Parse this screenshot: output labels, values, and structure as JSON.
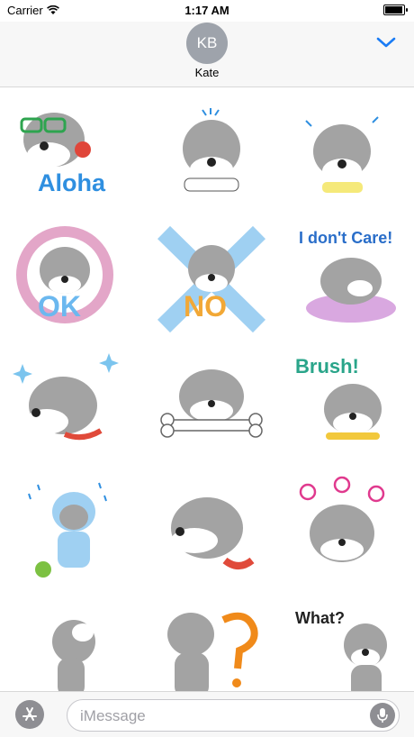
{
  "status_bar": {
    "carrier": "Carrier",
    "time": "1:17 AM"
  },
  "header": {
    "avatar_initials": "KB",
    "contact_name": "Kate"
  },
  "stickers": [
    {
      "label": "Aloha",
      "color": "#2f8fe0"
    },
    {
      "label": ""
    },
    {
      "label": ""
    },
    {
      "label": "OK",
      "color": "#6bb8ef"
    },
    {
      "label": "NO",
      "color": "#f2a836"
    },
    {
      "label": "I don't Care!",
      "color": "#2a6ec9"
    },
    {
      "label": ""
    },
    {
      "label": ""
    },
    {
      "label": "Brush!",
      "color": "#2aa58a"
    },
    {
      "label": ""
    },
    {
      "label": ""
    },
    {
      "label": ""
    },
    {
      "label": ""
    },
    {
      "label": ""
    },
    {
      "label": "What?",
      "color": "#222222"
    }
  ],
  "composer": {
    "placeholder": "iMessage"
  },
  "colors": {
    "accent": "#1a7cf5",
    "dog_gray": "#9a9a9a",
    "collar_red": "#e04a3a",
    "frog_green": "#7cc142",
    "swirl_pink": "#e03a8e"
  }
}
